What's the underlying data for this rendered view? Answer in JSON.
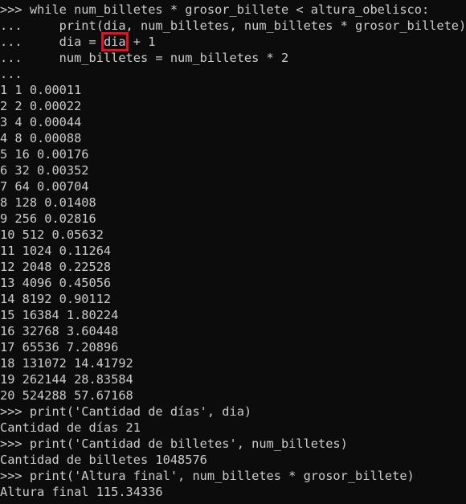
{
  "terminal": {
    "lines": [
      ">>> while num_billetes * grosor_billete < altura_obelisco:",
      "...     print(dia, num_billetes, num_billetes * grosor_billete)",
      "...     dia = ",
      "...     num_billetes = num_billetes * 2",
      "...",
      "1 1 0.00011",
      "2 2 0.00022",
      "3 4 0.00044",
      "4 8 0.00088",
      "5 16 0.00176",
      "6 32 0.00352",
      "7 64 0.00704",
      "8 128 0.01408",
      "9 256 0.02816",
      "10 512 0.05632",
      "11 1024 0.11264",
      "12 2048 0.22528",
      "13 4096 0.45056",
      "14 8192 0.90112",
      "15 16384 1.80224",
      "16 32768 3.60448",
      "17 65536 7.20896",
      "18 131072 14.41792",
      "19 262144 28.83584",
      "20 524288 57.67168",
      ">>> print('Cantidad de días', dia)",
      "Cantidad de días 21",
      ">>> print('Cantidad de billetes', num_billetes)",
      "Cantidad de billetes 1048576",
      ">>> print('Altura final', num_billetes * grosor_billete)",
      "Altura final 115.34336"
    ],
    "highlight_word": "dia",
    "highlight_suffix": " + 1",
    "colors": {
      "background": "#0c0c0c",
      "text": "#cccccc",
      "highlight_border": "#e81123"
    }
  }
}
